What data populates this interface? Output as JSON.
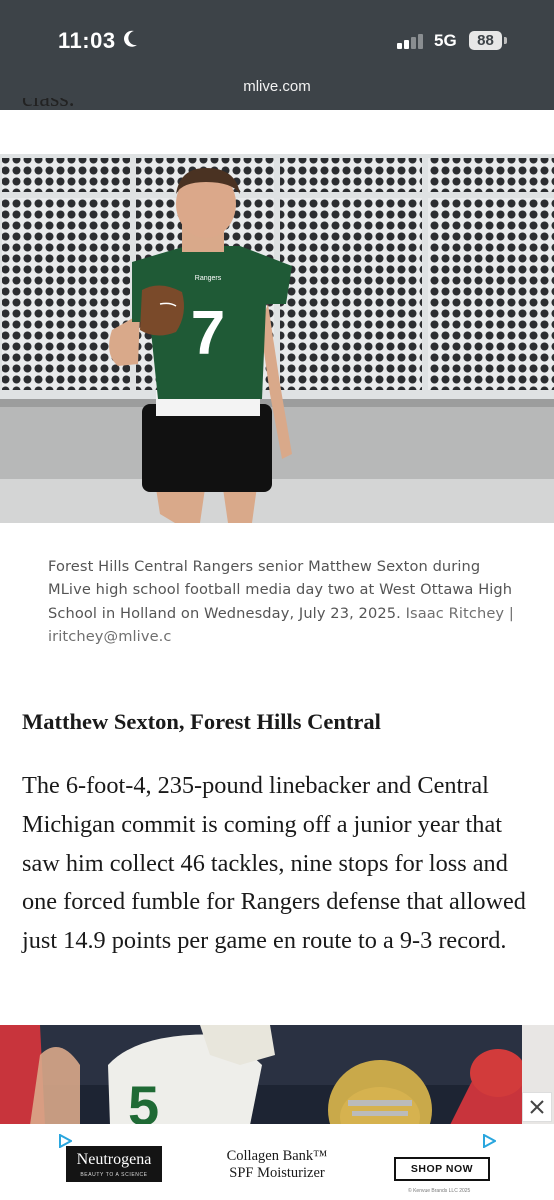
{
  "status_bar": {
    "time": "11:03",
    "network": "5G",
    "battery": "88"
  },
  "url_bar": {
    "url": "mlive.com"
  },
  "article": {
    "cutoff_text": "class.",
    "photo1": {
      "jersey_number": "7",
      "jersey_name": "Rangers"
    },
    "caption": {
      "text": "Forest Hills Central Rangers senior Matthew Sexton during MLive high school football media day two at West Ottawa High School in Holland on Wednesday, July 23, 2025.",
      "credit": "Isaac Ritchey | iritchey@mlive.c"
    },
    "heading": "Matthew Sexton, Forest Hills Central",
    "body": "The 6-foot-4, 235-pound linebacker and Central Michigan commit is coming off a junior year that saw him collect 46 tackles, nine stops for loss and one forced fumble for Rangers defense that allowed just 14.9 points per game en route to a 9-3 record.",
    "photo2": {
      "jersey_number": "5"
    }
  },
  "ad": {
    "brand": "Neutrogena",
    "brand_tagline": "BEAUTY TO A SCIENCE",
    "product_line1": "Collagen Bank™",
    "product_line2": "SPF Moisturizer",
    "cta": "SHOP NOW",
    "legal": "© Kenvue Brands LLC 2025"
  },
  "colors": {
    "topbar": "#3d4348",
    "jersey_green": "#1f5a36",
    "ad_marker": "#2aa6de"
  },
  "icons": {
    "moon": "moon-icon",
    "signal": "cellular-signal-icon",
    "battery": "battery-icon",
    "close": "close-icon",
    "adchoices": "adchoices-icon"
  }
}
